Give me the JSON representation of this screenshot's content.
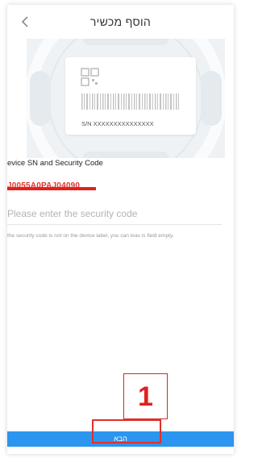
{
  "header": {
    "title": "הוסף מכשיר"
  },
  "hero": {
    "serial_label": "S/N  XXXXXXXXXXXXXXX"
  },
  "form": {
    "section_title": "evice SN and Security Code",
    "serial_value": "J0055A0PAJ04090",
    "security_placeholder": "Please enter the security code",
    "hint_text": "the security code is not on the device label, you can leav is field empty."
  },
  "footer": {
    "next_label": "הבא"
  },
  "annotation": {
    "step_number": "1"
  },
  "colors": {
    "accent_blue": "#2b95ef",
    "annotation_red": "#e0211c"
  }
}
